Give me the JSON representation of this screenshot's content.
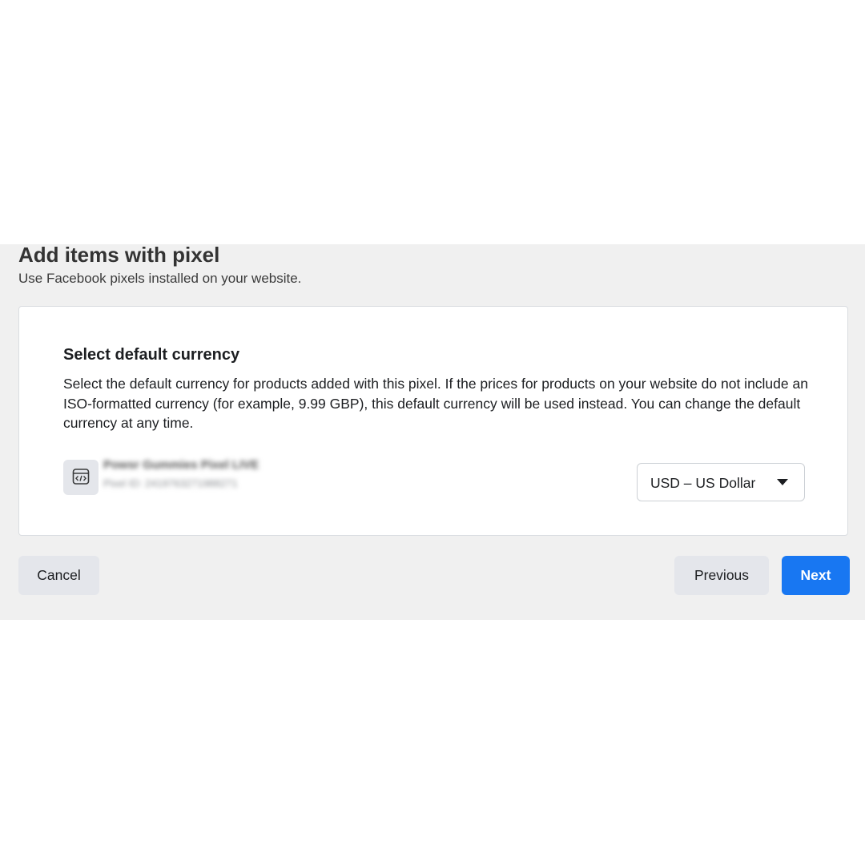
{
  "header": {
    "title": "Add items with pixel",
    "subtitle": "Use Facebook pixels installed on your website."
  },
  "card": {
    "heading": "Select default currency",
    "description": "Select the default currency for products added with this pixel. If the prices for products on your website do not include an ISO-formatted currency (for example, 9.99 GBP), this default currency will be used instead. You can change the default currency at any time."
  },
  "pixel": {
    "icon": "code-window-icon",
    "name": "Powsr Gummies Pixel LIVE",
    "id": "Pixel ID: 2419763271988271",
    "blurred": true
  },
  "currency_select": {
    "selected": "USD – US Dollar"
  },
  "footer": {
    "cancel_label": "Cancel",
    "previous_label": "Previous",
    "next_label": "Next"
  },
  "colors": {
    "primary": "#1877f2",
    "panel_bg": "#f0f0f0",
    "secondary_button": "#e4e6eb"
  }
}
